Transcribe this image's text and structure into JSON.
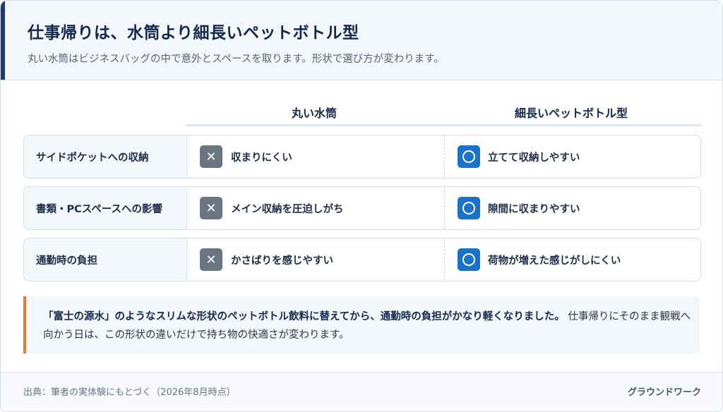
{
  "header": {
    "title": "仕事帰りは、水筒より細長いペットボトル型",
    "subtitle": "丸い水筒はビジネスバッグの中で意外とスペースを取ります。形状で選び方が変わります。"
  },
  "columns": [
    "丸い水筒",
    "細長いペットボトル型"
  ],
  "rows": [
    {
      "label": "サイドポケットへの収納",
      "a_icon": "cross-icon",
      "a": "収まりにくい",
      "b_icon": "circle-icon",
      "b": "立てて収納しやすい"
    },
    {
      "label": "書類・PCスペースへの影響",
      "a_icon": "cross-icon",
      "a": "メイン収納を圧迫しがち",
      "b_icon": "circle-icon",
      "b": "隙間に収まりやすい"
    },
    {
      "label": "通勤時の負担",
      "a_icon": "cross-icon",
      "a": "かさばりを感じやすい",
      "b_icon": "circle-icon",
      "b": "荷物が増えた感じがしにくい"
    }
  ],
  "note": {
    "strong": "「富士の源水」のようなスリムな形状のペットボトル飲料に替えてから、通勤時の負担がかなり軽くなりました。",
    "rest": " 仕事帰りにそのまま観戦へ向かう日は、この形状の違いだけで持ち物の快適さが変わります。"
  },
  "footer": {
    "source": "出典：筆者の実体験にもとづく（2026年8月時点）",
    "brand": "グラウンドワーク"
  },
  "colors": {
    "accent": "#1c3a6b",
    "cross": "#6b7482",
    "circle": "#1a73c8",
    "note_bar": "#e07a3a"
  }
}
